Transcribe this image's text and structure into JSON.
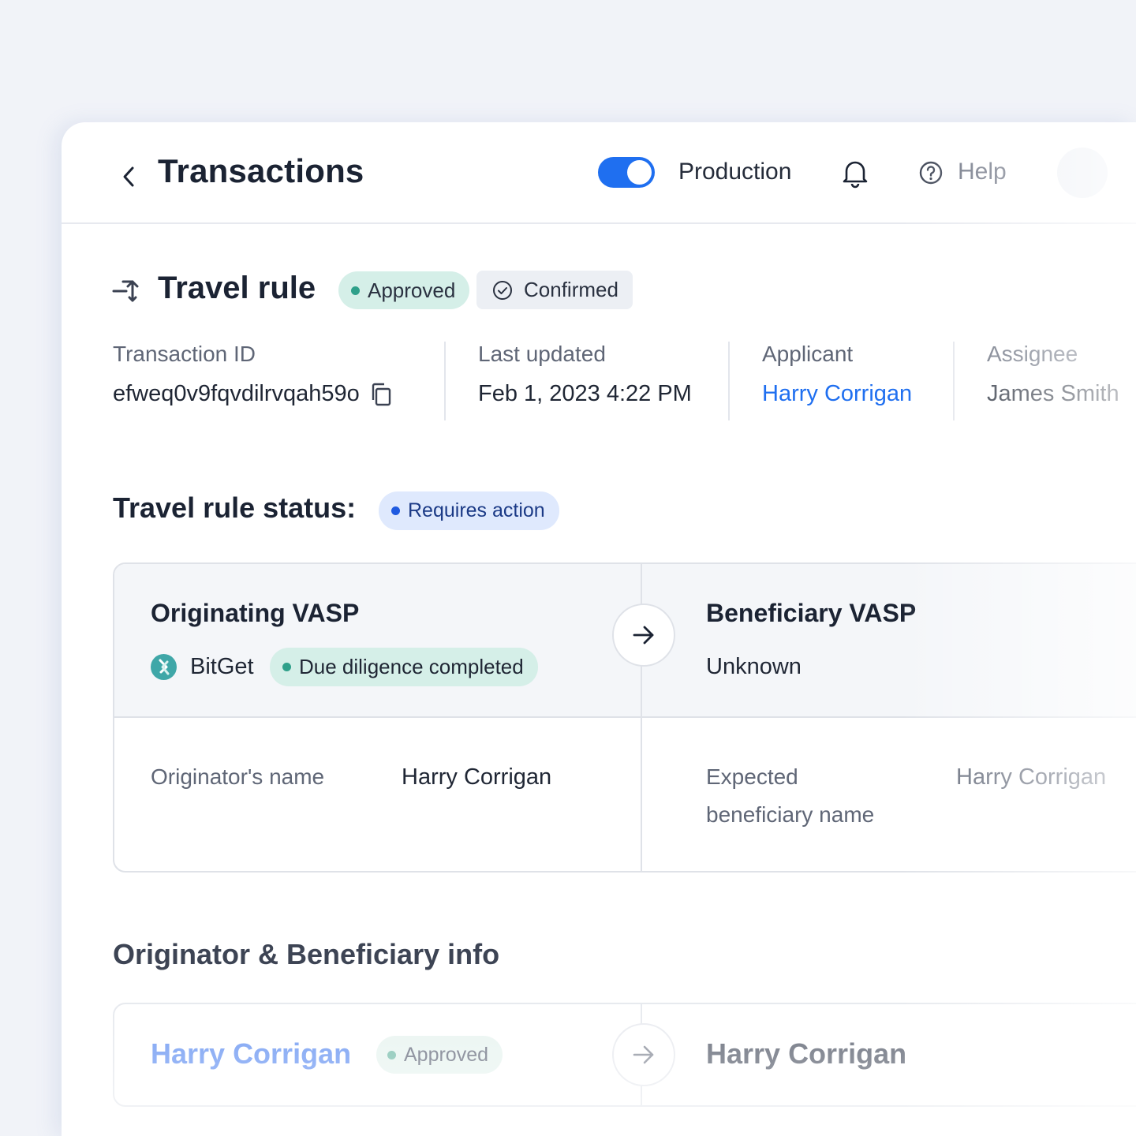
{
  "header": {
    "title": "Transactions",
    "environment_label": "Production",
    "help_label": "Help",
    "production_enabled": true
  },
  "rule": {
    "title": "Travel rule",
    "badges": {
      "approved": "Approved",
      "confirmed": "Confirmed"
    }
  },
  "meta": {
    "transaction_id": {
      "label": "Transaction ID",
      "value": "efweq0v9fqvdilrvqah59o"
    },
    "last_updated": {
      "label": "Last updated",
      "value": "Feb 1, 2023 4:22 PM"
    },
    "applicant": {
      "label": "Applicant",
      "value": "Harry Corrigan"
    },
    "assignee": {
      "label": "Assignee",
      "value": "James Smith"
    }
  },
  "status": {
    "title": "Travel rule status:",
    "badge": "Requires action"
  },
  "vasp": {
    "originating": {
      "heading": "Originating VASP",
      "name": "BitGet",
      "badge": "Due diligence completed",
      "field_label": "Originator's name",
      "field_value": "Harry Corrigan"
    },
    "beneficiary": {
      "heading": "Beneficiary VASP",
      "name": "Unknown",
      "field_label_line1": "Expected",
      "field_label_line2": "beneficiary name",
      "field_value": "Harry Corrigan"
    }
  },
  "info": {
    "title": "Originator & Beneficiary info",
    "originator_name": "Harry Corrigan",
    "originator_badge": "Approved",
    "beneficiary_name": "Harry Corrigan"
  },
  "colors": {
    "accent": "#1f6ff0",
    "approved_dot": "#2fa08a",
    "action_dot": "#1f5ae0",
    "bitget_logo": "#3fa7a8"
  },
  "icons": {
    "back": "chevron-left-icon",
    "bell": "bell-icon",
    "help": "help-circle-icon",
    "rule": "travel-rule-icon",
    "confirmed": "check-circle-icon",
    "copy": "copy-icon",
    "arrow": "arrow-right-icon"
  }
}
